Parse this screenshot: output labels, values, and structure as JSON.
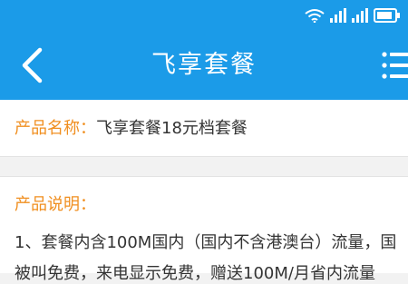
{
  "status_bar": {
    "icons": [
      "wifi-icon",
      "signal-icon",
      "signal-icon",
      "battery-icon"
    ]
  },
  "header": {
    "back_icon": "chevron-left-icon",
    "title": "飞享套餐",
    "menu_icon": "list-menu-icon",
    "background": "#1b9be8"
  },
  "product": {
    "name_label": "产品名称：",
    "name_value": "飞享套餐18元档套餐"
  },
  "description": {
    "label": "产品说明：",
    "lines": [
      "1、套餐内含100M国内（国内不含港澳台）流量，国",
      "被叫免费，来电显示免费，赠送100M/月省内流量"
    ]
  },
  "accent_color": "#f08f20"
}
